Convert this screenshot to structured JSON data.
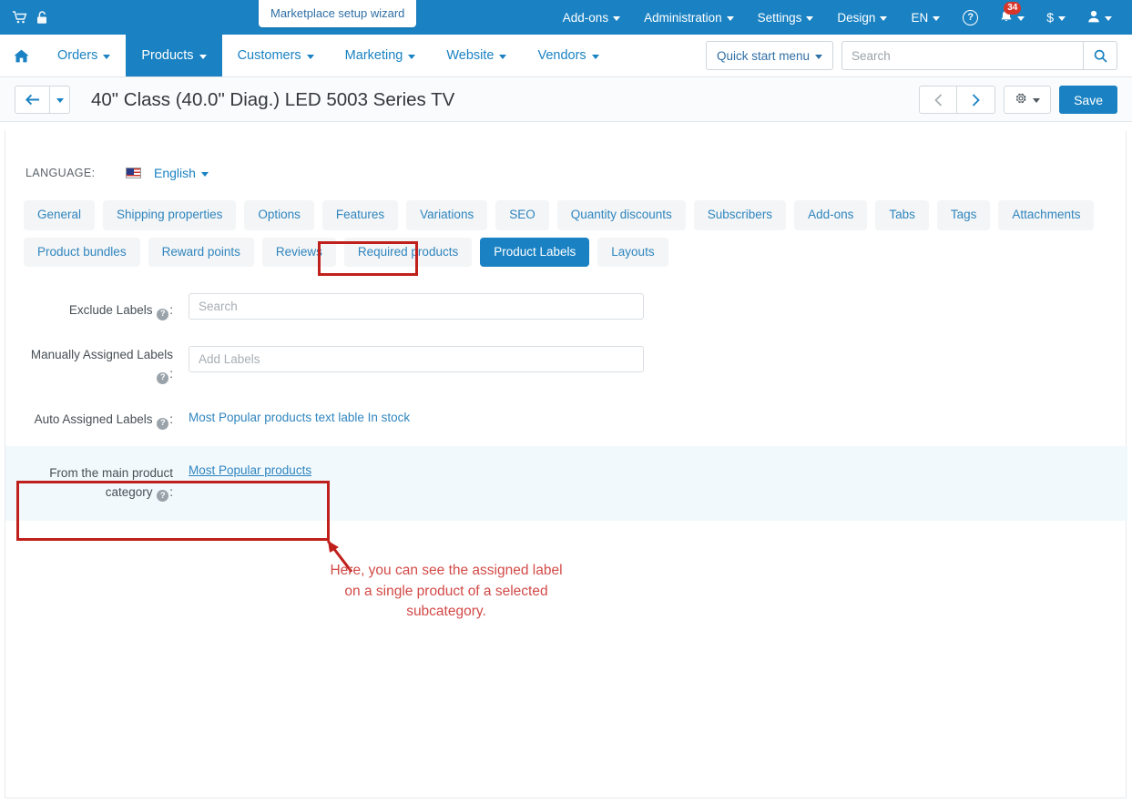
{
  "topbar": {
    "cart_icon": "cart-icon",
    "lock_icon": "unlock-icon",
    "wizard_label": "Marketplace setup wizard",
    "menus": [
      {
        "label": "Add-ons"
      },
      {
        "label": "Administration"
      },
      {
        "label": "Settings"
      },
      {
        "label": "Design"
      },
      {
        "label": "EN"
      }
    ],
    "help_label": "?",
    "notifications_count": "34",
    "currency_label": "$",
    "bell_icon": "bell-icon",
    "user_icon": "user-icon",
    "bg_color": "#1a82c3"
  },
  "mainnav": {
    "home_icon": "home-icon",
    "items": [
      {
        "label": "Orders",
        "active": false
      },
      {
        "label": "Products",
        "active": true
      },
      {
        "label": "Customers",
        "active": false
      },
      {
        "label": "Marketing",
        "active": false
      },
      {
        "label": "Website",
        "active": false
      },
      {
        "label": "Vendors",
        "active": false
      }
    ],
    "quick_start_label": "Quick start menu",
    "search_placeholder": "Search",
    "search_value": "",
    "search_icon": "search-icon"
  },
  "titlebar": {
    "back_icon": "arrow-left-icon",
    "back_caret_icon": "chevron-down-icon",
    "title": "40\" Class (40.0\" Diag.) LED 5003 Series TV",
    "prev_icon": "chevron-left-icon",
    "next_icon": "chevron-right-icon",
    "gear_icon": "gear-icon",
    "save_label": "Save",
    "save_color": "#1a82c3"
  },
  "language": {
    "label": "LANGUAGE:",
    "flag_icon": "us-flag-icon",
    "selected": "English"
  },
  "tabs": [
    {
      "label": "General",
      "active": false
    },
    {
      "label": "Shipping properties",
      "active": false
    },
    {
      "label": "Options",
      "active": false
    },
    {
      "label": "Features",
      "active": false
    },
    {
      "label": "Variations",
      "active": false
    },
    {
      "label": "SEO",
      "active": false
    },
    {
      "label": "Quantity discounts",
      "active": false
    },
    {
      "label": "Subscribers",
      "active": false
    },
    {
      "label": "Add-ons",
      "active": false
    },
    {
      "label": "Tabs",
      "active": false
    },
    {
      "label": "Tags",
      "active": false
    },
    {
      "label": "Attachments",
      "active": false
    },
    {
      "label": "Product bundles",
      "active": false
    },
    {
      "label": "Reward points",
      "active": false
    },
    {
      "label": "Reviews",
      "active": false
    },
    {
      "label": "Required products",
      "active": false
    },
    {
      "label": "Product Labels",
      "active": true
    },
    {
      "label": "Layouts",
      "active": false
    }
  ],
  "form": {
    "exclude_labels": {
      "label": "Exclude Labels",
      "suffix": ":",
      "placeholder": "Search",
      "value": ""
    },
    "manually_assigned": {
      "label_line1": "Manually Assigned Labels",
      "suffix": ":",
      "placeholder": "Add Labels",
      "value": ""
    },
    "auto_assigned": {
      "label": "Auto Assigned Labels",
      "suffix": ":",
      "value": "Most Popular products text lable In stock"
    },
    "main_category": {
      "label_line1": "From the main product",
      "label_line2": "category",
      "suffix": ":",
      "value": "Most Popular products"
    }
  },
  "annotations": {
    "callout_text": "Here, you can see the assigned label on a single product of a selected subcategory.",
    "color": "#c0201c",
    "text_color": "#d24a47"
  }
}
